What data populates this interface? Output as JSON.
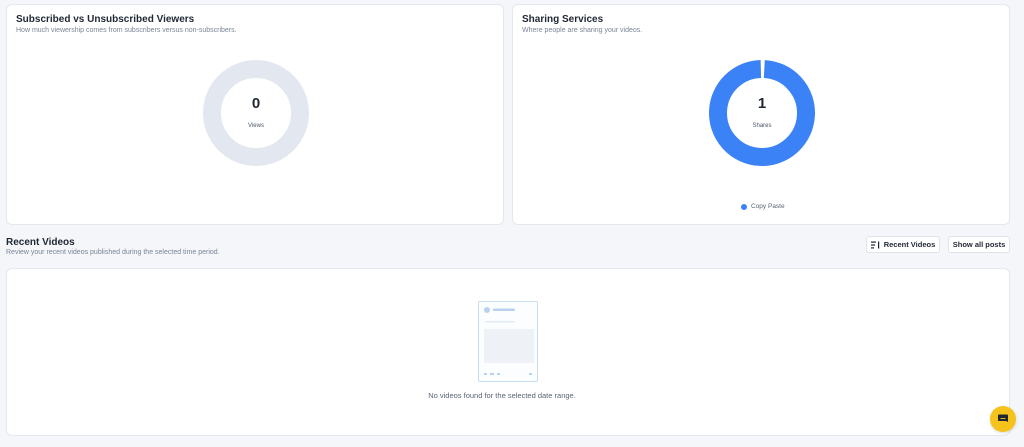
{
  "subscribed_card": {
    "title": "Subscribed vs Unsubscribed Viewers",
    "subtitle": "How much viewership comes from subscribers versus non-subscribers.",
    "value": "0",
    "value_label": "Views",
    "ring_color": "#e3e8f0"
  },
  "sharing_card": {
    "title": "Sharing Services",
    "subtitle": "Where people are sharing your videos.",
    "value": "1",
    "value_label": "Shares",
    "ring_color": "#3b82f6",
    "legend": [
      {
        "label": "Copy Paste",
        "color": "#3b82f6"
      }
    ]
  },
  "recent_videos": {
    "title": "Recent Videos",
    "subtitle": "Review your recent videos published during the selected time period.",
    "filter_button_label": "Recent Videos",
    "show_all_label": "Show all posts",
    "empty_message": "No videos found for the selected date range."
  },
  "chat": {
    "icon": "chat-icon",
    "color": "#f6c21c"
  }
}
